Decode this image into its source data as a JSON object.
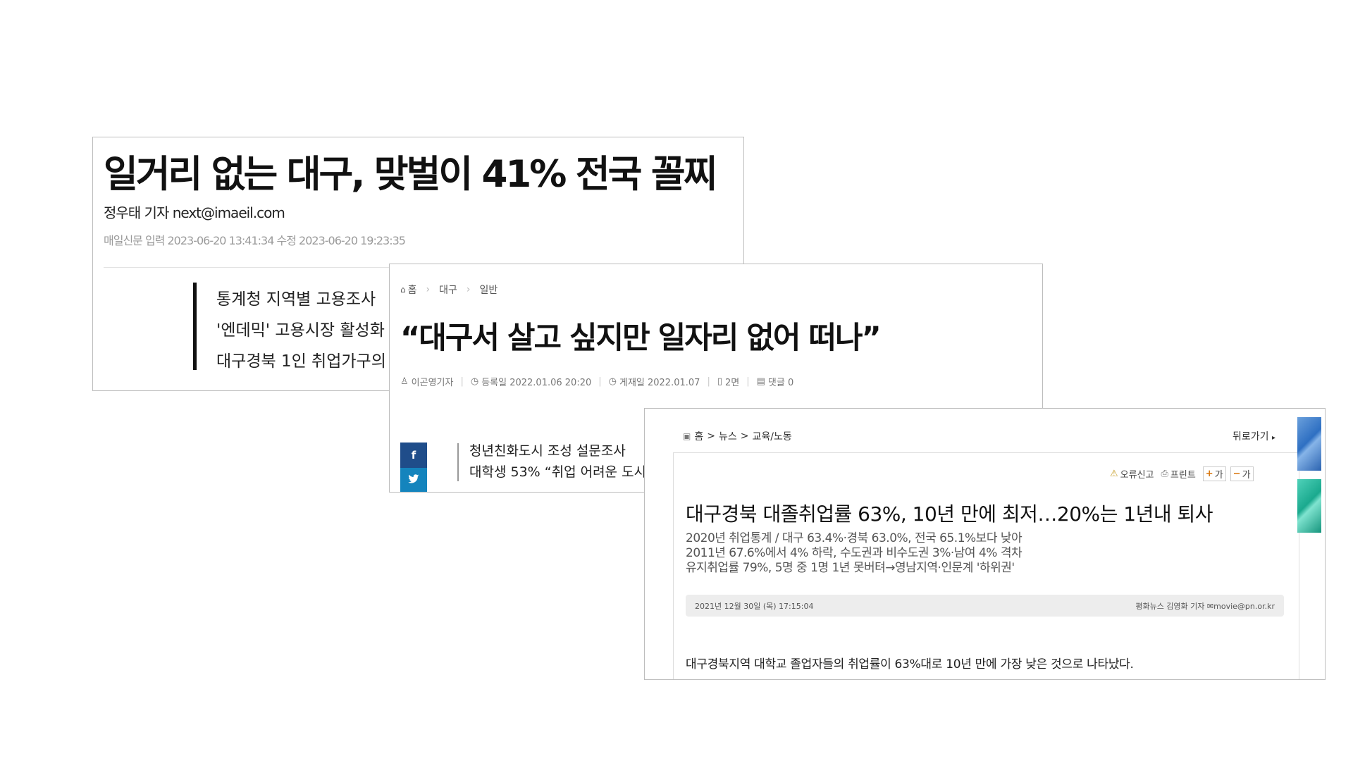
{
  "card1": {
    "headline": "일거리 없는 대구, 맞벌이 41% 전국 꼴찌",
    "byline": "정우태 기자 next@imaeil.com",
    "meta": "매일신문 입력 2023-06-20 13:41:34 수정 2023-06-20 19:23:35",
    "related": [
      "통계청 지역별 고용조사",
      "'엔데믹' 고용시장 활성화",
      "대구경북 1인 취업가구의"
    ]
  },
  "card2": {
    "breadcrumb": {
      "home": "홈",
      "level1": "대구",
      "level2": "일반"
    },
    "headline": "“대구서 살고 싶지만 일자리 없어 떠나”",
    "meta": {
      "reporter": "이곤영기자",
      "registered": "등록일 2022.01.06 20:20",
      "published": "게재일 2022.01.07",
      "page": "2면",
      "comments": "댓글 0"
    },
    "social": {
      "facebook": "f",
      "twitter": "t"
    },
    "related": [
      "청년친화도시 조성 설문조사",
      "대학생 53% “취업 어려운 도시"
    ]
  },
  "card3": {
    "breadcrumb": {
      "home": "홈",
      "sep": ">",
      "level1": "뉴스",
      "level2": "교육/노동"
    },
    "back": "뒤로가기",
    "tools": {
      "report": "오류신고",
      "print": "프린트",
      "font_up": "가",
      "font_down": "가"
    },
    "headline": "대구경북 대졸취업률 63%, 10년 만에 최저…20%는 1년내 퇴사",
    "subheads": [
      "2020년 취업통계 / 대구 63.4%·경북 63.0%, 전국 65.1%보다 낮아",
      "2011년 67.6%에서 4% 하락, 수도권과 비수도권 3%·남여 4% 격차",
      "유지취업률 79%, 5명 중 1명 1년 못버텨→영남지역·인문계 '하위권'"
    ],
    "date": "2021년 12월 30일 (목) 17:15:04",
    "reporter": "평화뉴스 김영화 기자",
    "email": "movie@pn.or.kr",
    "body": "대구경북지역 대학교 졸업자들의 취업률이 63%대로 10년 만에 가장 낮은 것으로 나타났다."
  }
}
